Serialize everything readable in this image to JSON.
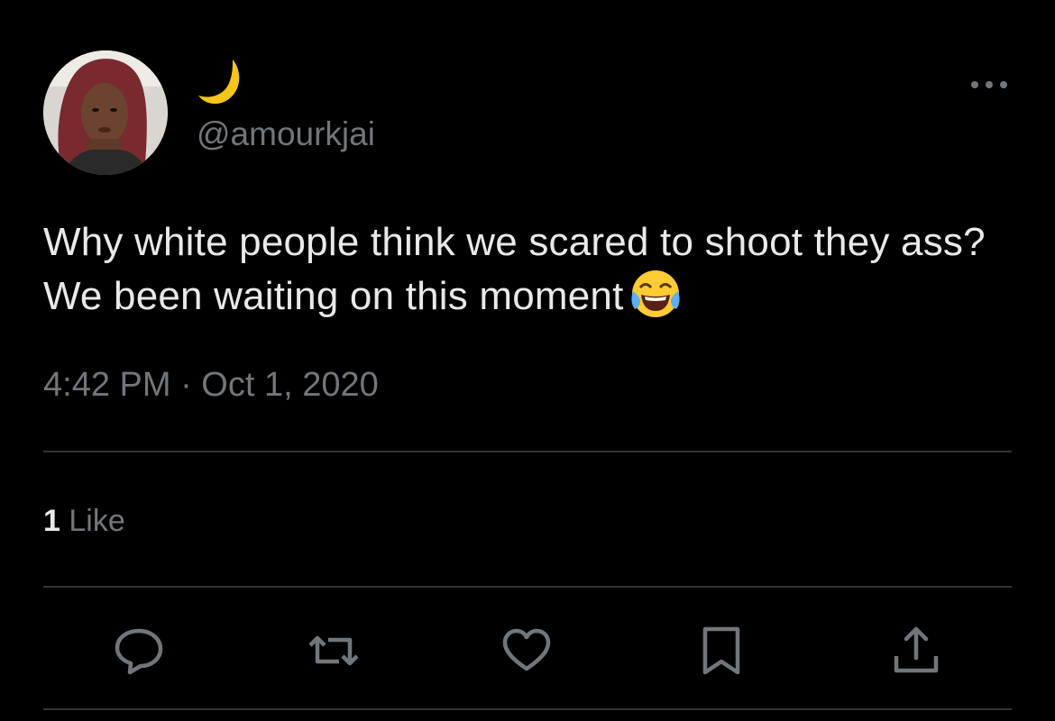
{
  "user": {
    "display_name_icon": "crescent-moon-emoji",
    "handle": "@amourkjai",
    "avatar_icon": "profile-photo"
  },
  "tweet": {
    "text": "Why white people think we scared to shoot they ass? We been waiting on this moment",
    "emoji_icon": "face-with-tears-of-joy-emoji",
    "timestamp": "4:42 PM · Oct 1, 2020"
  },
  "stats": {
    "like_count": "1",
    "like_label": "Like"
  },
  "actions": [
    {
      "name": "reply",
      "icon": "speech-bubble-icon"
    },
    {
      "name": "retweet",
      "icon": "retweet-arrows-icon"
    },
    {
      "name": "like",
      "icon": "heart-icon"
    },
    {
      "name": "bookmark",
      "icon": "bookmark-icon"
    },
    {
      "name": "share",
      "icon": "share-upload-icon"
    }
  ],
  "colors": {
    "background": "#000000",
    "primary_text": "#e7e9ea",
    "secondary_text": "#71767b",
    "divider": "#2f3336",
    "moon": "#f5c518"
  }
}
